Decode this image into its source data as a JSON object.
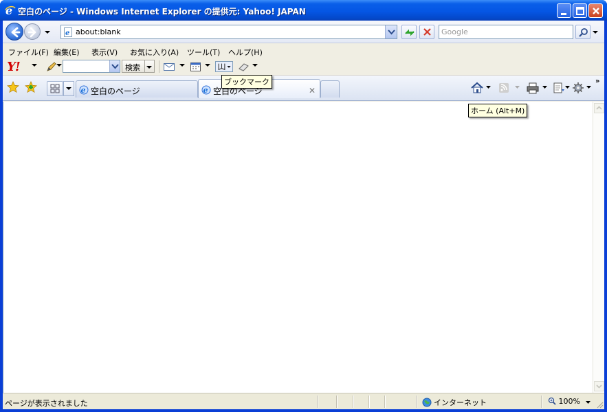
{
  "window": {
    "title": "空白のページ - Windows Internet Explorer の提供元: Yahoo! JAPAN"
  },
  "address_bar": {
    "url": "about:blank"
  },
  "search": {
    "placeholder": "Google"
  },
  "menu": {
    "items": [
      "ファイル(F)",
      "編集(E)",
      "表示(V)",
      "お気に入り(A)",
      "ツール(T)",
      "ヘルプ(H)"
    ]
  },
  "yahoo_toolbar": {
    "logo": "Y!",
    "search_button": "検索"
  },
  "tabs": [
    {
      "label": "空白のページ",
      "active": false
    },
    {
      "label": "空白のページ",
      "active": true
    }
  ],
  "tooltips": {
    "bookmark": "ブックマーク",
    "home": "ホーム (Alt+M)"
  },
  "statusbar": {
    "status": "ページが表示されました",
    "zone": "インターネット",
    "zoom": "100%"
  },
  "colors": {
    "titlebar": "#0556e4",
    "yahoo_red": "#d20000",
    "tooltip_bg": "#ffffe1"
  }
}
